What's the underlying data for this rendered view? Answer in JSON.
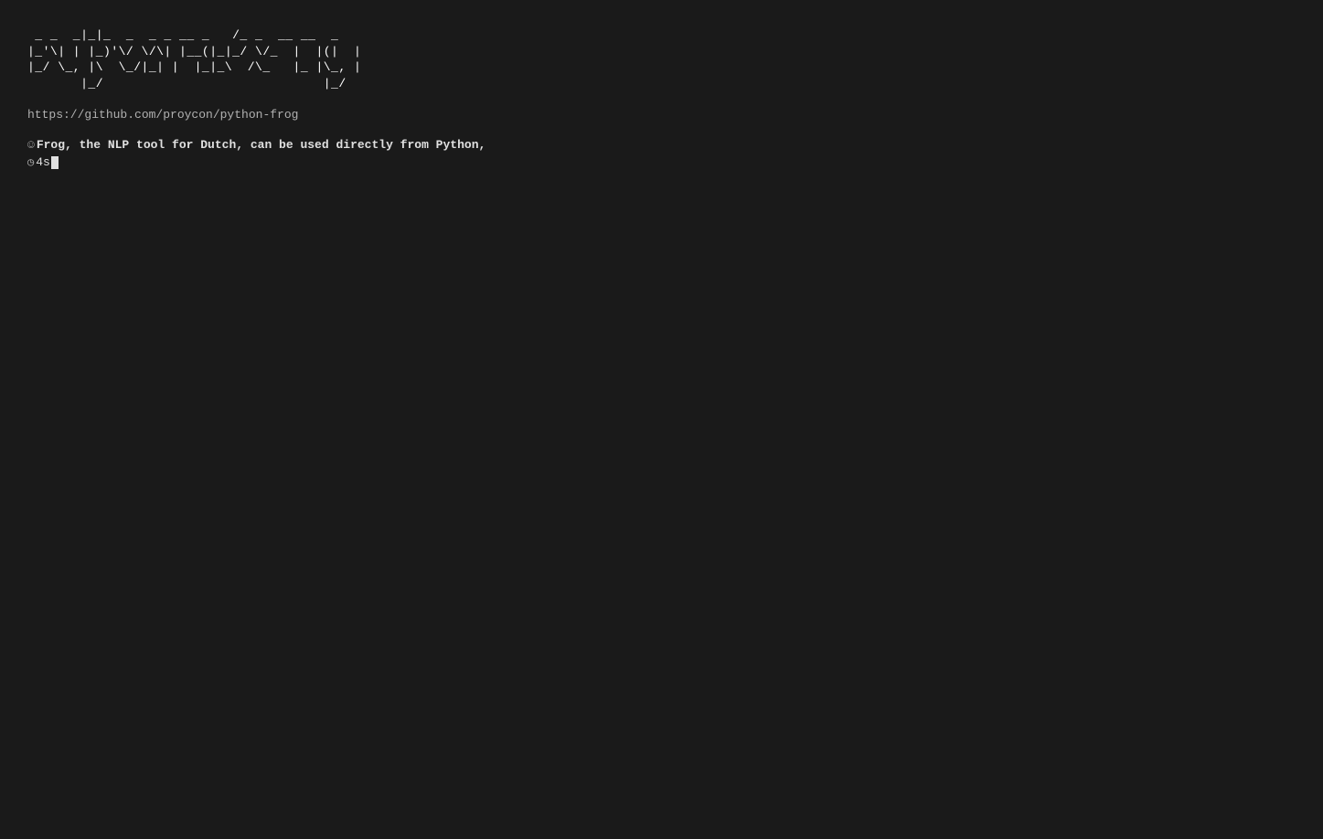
{
  "terminal": {
    "background": "#1a1a1a",
    "ascii_art": " _ _  _|_|_  _  _ _  _  _ _  _ _  _  _  _ _ \n|_'\\| | |_)'\\/ \\|\\| |__|(|_|_/ \\/_ |  |(| | \n|_/ \\_, |\\  \\_/|_| |  | |_|_\\ /\\_  |_ |\\_, |\n|_|   |_/                           |_/",
    "url": "https://github.com/proycon/python-frog",
    "output_line1": {
      "prefix_icon": "☺",
      "text": "Frog, the NLP tool for Dutch, can be used directly from Python,"
    },
    "output_line2": {
      "prefix_icon": "◷",
      "text": "4s",
      "has_cursor": true
    }
  }
}
